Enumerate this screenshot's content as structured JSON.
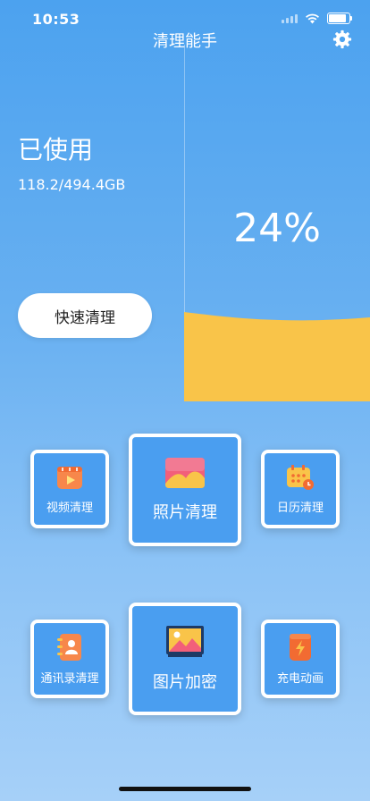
{
  "status": {
    "time": "10:53"
  },
  "header": {
    "title": "清理能手"
  },
  "storage": {
    "used_label": "已使用",
    "used_amount": "118.2/494.4GB",
    "percent_text": "24%",
    "percent_value": 0.24
  },
  "actions": {
    "quick_clean": "快速清理"
  },
  "tiles": {
    "video": "视频清理",
    "photo": "照片清理",
    "calendar": "日历清理",
    "contacts": "通讯录清理",
    "encrypt": "图片加密",
    "charge": "充电动画"
  },
  "colors": {
    "accent": "#4a9ef0",
    "wave": "#f9c449",
    "background_top": "#4ca2ef",
    "background_bottom": "#a6d0f8"
  },
  "icons": [
    "settings-gear-icon",
    "video-icon",
    "photo-icon",
    "calendar-icon",
    "contacts-book-icon",
    "image-lock-icon",
    "charging-animation-icon"
  ]
}
